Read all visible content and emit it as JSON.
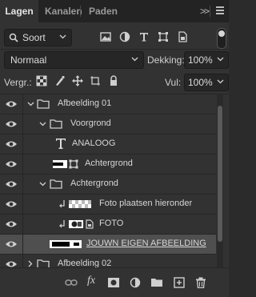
{
  "tabs": [
    {
      "label": "Lagen",
      "active": true
    },
    {
      "label": "Kanalen",
      "active": false
    },
    {
      "label": "Paden",
      "active": false
    }
  ],
  "panel_menu": {
    "collapse_label": ">>"
  },
  "filter": {
    "kind_label": "Soort",
    "icons": [
      "image-filter-icon",
      "adjustment-filter-icon",
      "type-filter-icon",
      "shape-filter-icon",
      "smart-object-filter-icon"
    ]
  },
  "blend": {
    "mode": "Normaal",
    "opacity_label": "Dekking:",
    "opacity_value": "100%"
  },
  "lock": {
    "label": "Vergr.:",
    "fill_label": "Vul:",
    "fill_value": "100%"
  },
  "layers": [
    {
      "name": "Afbeelding 01",
      "type": "group",
      "expanded": true,
      "indent": 0
    },
    {
      "name": "Voorgrond",
      "type": "group",
      "expanded": true,
      "indent": 1
    },
    {
      "name": "ANALOOG",
      "type": "text",
      "indent": 2
    },
    {
      "name": "Achtergrond",
      "type": "smart-object",
      "indent": 2
    },
    {
      "name": "Achtergrond",
      "type": "group",
      "expanded": true,
      "indent": 1
    },
    {
      "name": "Foto plaatsen hieronder",
      "type": "clipped-layer",
      "indent": 2
    },
    {
      "name": "FOTO",
      "type": "clipped-smart-object",
      "indent": 2
    },
    {
      "name": "JOUWN EIGEN AFBEELDING",
      "type": "layer",
      "indent": 1,
      "selected": true
    },
    {
      "name": "Afbeelding 02",
      "type": "group",
      "expanded": false,
      "indent": 0
    }
  ],
  "footer_icons": [
    "link-layers-icon",
    "fx-icon",
    "add-mask-icon",
    "adjustment-layer-icon",
    "new-group-icon",
    "new-layer-icon",
    "delete-icon"
  ],
  "footer_fx_label": "fx"
}
